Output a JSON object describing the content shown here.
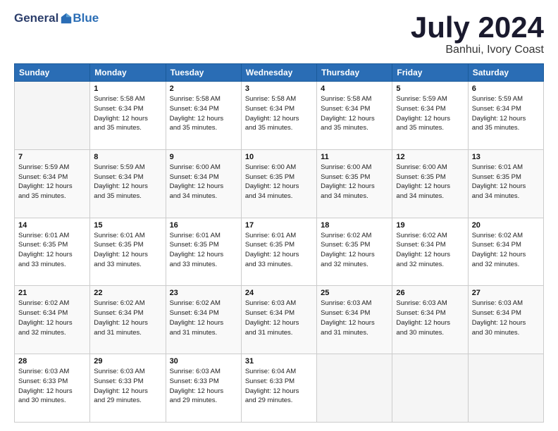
{
  "header": {
    "logo_general": "General",
    "logo_blue": "Blue",
    "month_title": "July 2024",
    "location": "Banhui, Ivory Coast"
  },
  "days_of_week": [
    "Sunday",
    "Monday",
    "Tuesday",
    "Wednesday",
    "Thursday",
    "Friday",
    "Saturday"
  ],
  "weeks": [
    [
      {
        "day": "",
        "info": ""
      },
      {
        "day": "1",
        "info": "Sunrise: 5:58 AM\nSunset: 6:34 PM\nDaylight: 12 hours\nand 35 minutes."
      },
      {
        "day": "2",
        "info": "Sunrise: 5:58 AM\nSunset: 6:34 PM\nDaylight: 12 hours\nand 35 minutes."
      },
      {
        "day": "3",
        "info": "Sunrise: 5:58 AM\nSunset: 6:34 PM\nDaylight: 12 hours\nand 35 minutes."
      },
      {
        "day": "4",
        "info": "Sunrise: 5:58 AM\nSunset: 6:34 PM\nDaylight: 12 hours\nand 35 minutes."
      },
      {
        "day": "5",
        "info": "Sunrise: 5:59 AM\nSunset: 6:34 PM\nDaylight: 12 hours\nand 35 minutes."
      },
      {
        "day": "6",
        "info": "Sunrise: 5:59 AM\nSunset: 6:34 PM\nDaylight: 12 hours\nand 35 minutes."
      }
    ],
    [
      {
        "day": "7",
        "info": "Sunrise: 5:59 AM\nSunset: 6:34 PM\nDaylight: 12 hours\nand 35 minutes."
      },
      {
        "day": "8",
        "info": "Sunrise: 5:59 AM\nSunset: 6:34 PM\nDaylight: 12 hours\nand 35 minutes."
      },
      {
        "day": "9",
        "info": "Sunrise: 6:00 AM\nSunset: 6:34 PM\nDaylight: 12 hours\nand 34 minutes."
      },
      {
        "day": "10",
        "info": "Sunrise: 6:00 AM\nSunset: 6:35 PM\nDaylight: 12 hours\nand 34 minutes."
      },
      {
        "day": "11",
        "info": "Sunrise: 6:00 AM\nSunset: 6:35 PM\nDaylight: 12 hours\nand 34 minutes."
      },
      {
        "day": "12",
        "info": "Sunrise: 6:00 AM\nSunset: 6:35 PM\nDaylight: 12 hours\nand 34 minutes."
      },
      {
        "day": "13",
        "info": "Sunrise: 6:01 AM\nSunset: 6:35 PM\nDaylight: 12 hours\nand 34 minutes."
      }
    ],
    [
      {
        "day": "14",
        "info": "Sunrise: 6:01 AM\nSunset: 6:35 PM\nDaylight: 12 hours\nand 33 minutes."
      },
      {
        "day": "15",
        "info": "Sunrise: 6:01 AM\nSunset: 6:35 PM\nDaylight: 12 hours\nand 33 minutes."
      },
      {
        "day": "16",
        "info": "Sunrise: 6:01 AM\nSunset: 6:35 PM\nDaylight: 12 hours\nand 33 minutes."
      },
      {
        "day": "17",
        "info": "Sunrise: 6:01 AM\nSunset: 6:35 PM\nDaylight: 12 hours\nand 33 minutes."
      },
      {
        "day": "18",
        "info": "Sunrise: 6:02 AM\nSunset: 6:35 PM\nDaylight: 12 hours\nand 32 minutes."
      },
      {
        "day": "19",
        "info": "Sunrise: 6:02 AM\nSunset: 6:34 PM\nDaylight: 12 hours\nand 32 minutes."
      },
      {
        "day": "20",
        "info": "Sunrise: 6:02 AM\nSunset: 6:34 PM\nDaylight: 12 hours\nand 32 minutes."
      }
    ],
    [
      {
        "day": "21",
        "info": "Sunrise: 6:02 AM\nSunset: 6:34 PM\nDaylight: 12 hours\nand 32 minutes."
      },
      {
        "day": "22",
        "info": "Sunrise: 6:02 AM\nSunset: 6:34 PM\nDaylight: 12 hours\nand 31 minutes."
      },
      {
        "day": "23",
        "info": "Sunrise: 6:02 AM\nSunset: 6:34 PM\nDaylight: 12 hours\nand 31 minutes."
      },
      {
        "day": "24",
        "info": "Sunrise: 6:03 AM\nSunset: 6:34 PM\nDaylight: 12 hours\nand 31 minutes."
      },
      {
        "day": "25",
        "info": "Sunrise: 6:03 AM\nSunset: 6:34 PM\nDaylight: 12 hours\nand 31 minutes."
      },
      {
        "day": "26",
        "info": "Sunrise: 6:03 AM\nSunset: 6:34 PM\nDaylight: 12 hours\nand 30 minutes."
      },
      {
        "day": "27",
        "info": "Sunrise: 6:03 AM\nSunset: 6:34 PM\nDaylight: 12 hours\nand 30 minutes."
      }
    ],
    [
      {
        "day": "28",
        "info": "Sunrise: 6:03 AM\nSunset: 6:33 PM\nDaylight: 12 hours\nand 30 minutes."
      },
      {
        "day": "29",
        "info": "Sunrise: 6:03 AM\nSunset: 6:33 PM\nDaylight: 12 hours\nand 29 minutes."
      },
      {
        "day": "30",
        "info": "Sunrise: 6:03 AM\nSunset: 6:33 PM\nDaylight: 12 hours\nand 29 minutes."
      },
      {
        "day": "31",
        "info": "Sunrise: 6:04 AM\nSunset: 6:33 PM\nDaylight: 12 hours\nand 29 minutes."
      },
      {
        "day": "",
        "info": ""
      },
      {
        "day": "",
        "info": ""
      },
      {
        "day": "",
        "info": ""
      }
    ]
  ]
}
